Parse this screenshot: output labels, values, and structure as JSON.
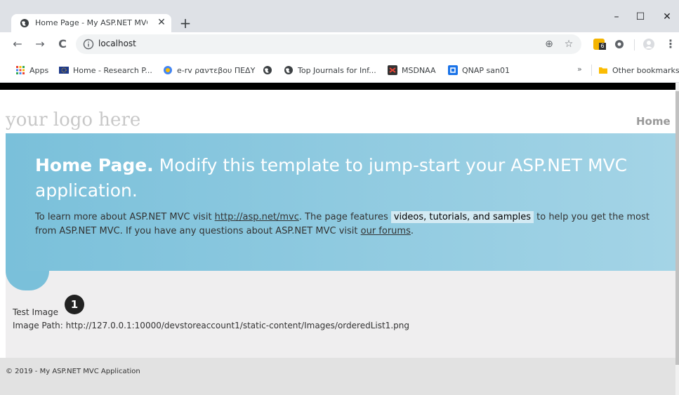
{
  "browser": {
    "tab_title": "Home Page - My ASP.NET MVC A",
    "tab_close": "✕",
    "new_tab": "+",
    "window": {
      "minimize": "–",
      "maximize": "☐",
      "close": "✕"
    },
    "nav": {
      "back": "←",
      "forward": "→",
      "reload": "C"
    },
    "url": "localhost",
    "omnibox_icons": {
      "zoom": "⊕",
      "star": "☆"
    },
    "menu": "⋮",
    "extension_badge": "6"
  },
  "bookmarks": [
    {
      "label": "Apps",
      "icon": "apps-grid-icon",
      "color": "#e53935"
    },
    {
      "label": "Home - Research P...",
      "icon": "eu-flag-icon",
      "color": "#1e3a8a"
    },
    {
      "label": "e-rv ραντεβου ΠΕΔΥ",
      "icon": "globe-icon",
      "color": "#4285f4"
    },
    {
      "label": "",
      "icon": "globe-icon",
      "color": "#5f6368"
    },
    {
      "label": "Top Journals for Inf...",
      "icon": "globe-icon",
      "color": "#5f6368"
    },
    {
      "label": "MSDNAA",
      "icon": "msdnaa-icon",
      "color": "#333333"
    },
    {
      "label": "QNAP san01",
      "icon": "qnap-icon",
      "color": "#1a73e8"
    }
  ],
  "bookmarks_more": "»",
  "bookmarks_other": "Other bookmarks",
  "site": {
    "logo": "your logo here",
    "menu_home": "Home"
  },
  "featured": {
    "title_bold": "Home Page.",
    "title_rest": " Modify this template to jump-start your ASP.NET MVC application.",
    "text_1": "To learn more about ASP.NET MVC visit ",
    "link_1": "http://asp.net/mvc",
    "text_2": ". The page features ",
    "highlight": "videos, tutorials, and samples",
    "text_3": " to help you get the most from ASP.NET MVC. If you have any questions about ASP.NET MVC visit ",
    "link_2": "our forums",
    "text_4": "."
  },
  "main": {
    "test_image_label": "Test Image",
    "badge_number": "1",
    "image_path_label": "Image Path: http://127.0.0.1:10000/devstoreaccount1/static-content/Images/orderedList1.png"
  },
  "footer": {
    "copyright": "© 2019 - My ASP.NET MVC Application"
  },
  "colors": {
    "featured_start": "#7ac0da",
    "featured_end": "#a4d4e6",
    "main_bg": "#efeeef",
    "footer_bg": "#e2e2e2"
  }
}
